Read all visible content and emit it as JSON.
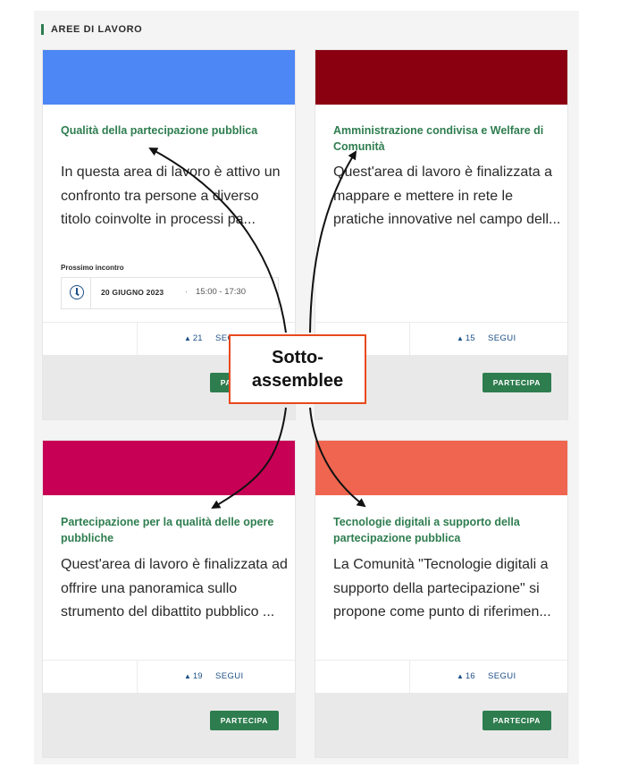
{
  "section_title": "AREE DI LAVORO",
  "colors": {
    "accent_green": "#2e7d4f",
    "link_blue": "#1c4f86",
    "callout_border": "#e8491d"
  },
  "cards": [
    {
      "banner_color": "#4d86f5",
      "title": "Qualità della partecipazione pubblica",
      "description": "In questa area di lavoro è attivo un confronto tra persone a diverso titolo coinvolte in processi pa...",
      "meeting": {
        "label": "Prossimo incontro",
        "icon": "clock-icon",
        "date": "20 GIUGNO 2023",
        "separator": "·",
        "time": "15:00 - 17:30"
      },
      "followers": "21",
      "follow_label": "SEGUI",
      "participate_label": "PARTECIPA"
    },
    {
      "banner_color": "#8a0011",
      "title": "Amministrazione condivisa e Welfare di Comunità",
      "description": "Quest'area di lavoro è finalizzata a mappare e mettere in rete le pratiche innovative nel campo dell...",
      "followers": "15",
      "follow_label": "SEGUI",
      "participate_label": "PARTECIPA"
    },
    {
      "banner_color": "#c70055",
      "title": "Partecipazione per la qualità delle opere pubbliche",
      "description": "Quest'area di lavoro è finalizzata ad offrire una panoramica sullo strumento del dibattito pubblico ...",
      "followers": "19",
      "follow_label": "SEGUI",
      "participate_label": "PARTECIPA"
    },
    {
      "banner_color": "#ef6550",
      "title": "Tecnologie digitali a supporto della partecipazione pubblica",
      "description": "La Comunità \"Tecnologie digitali a supporto della partecipazione\" si propone come punto di riferimen...",
      "followers": "16",
      "follow_label": "SEGUI",
      "participate_label": "PARTECIPA"
    }
  ],
  "callout": {
    "line1": "Sotto-",
    "line2": "assemblee"
  }
}
